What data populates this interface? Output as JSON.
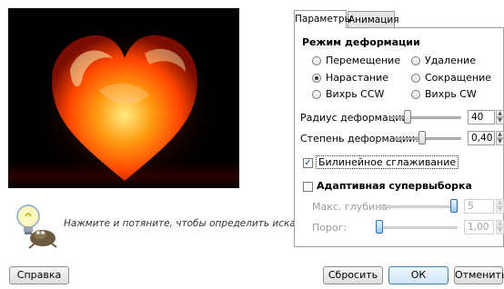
{
  "hint": {
    "text": "Нажмите и потяните, чтобы определить искажение.",
    "icon": "lightbulb-with-gimp-mascot-icon"
  },
  "tabs": [
    {
      "label": "Параметры",
      "active": true
    },
    {
      "label": "Анимация",
      "active": false
    }
  ],
  "deform_mode": {
    "heading": "Режим деформации",
    "options": [
      {
        "label": "Перемещение",
        "checked": false
      },
      {
        "label": "Удаление",
        "checked": false
      },
      {
        "label": "Нарастание",
        "checked": true
      },
      {
        "label": "Сокращение",
        "checked": false
      },
      {
        "label": "Вихрь CCW",
        "checked": false
      },
      {
        "label": "Вихрь CW",
        "checked": false
      }
    ]
  },
  "sliders": {
    "radius": {
      "label": "Радиус деформации:",
      "value": "40"
    },
    "amount": {
      "label": "Степень деформации:",
      "value": "0,40"
    }
  },
  "bilinear": {
    "label": "Билинейное сглаживание",
    "checked": true
  },
  "adaptive": {
    "label": "Адаптивная супервыборка",
    "checked": false,
    "max_depth": {
      "label": "Макс. глубина:",
      "value": "5"
    },
    "threshold": {
      "label": "Порог:",
      "value": "1,00"
    }
  },
  "buttons": {
    "help": "Справка",
    "reset": "Сбросить",
    "ok": "ОК",
    "cancel": "Отменить"
  },
  "colors": {
    "accent": "#3c7fb1",
    "heart": "#ff5a00"
  }
}
